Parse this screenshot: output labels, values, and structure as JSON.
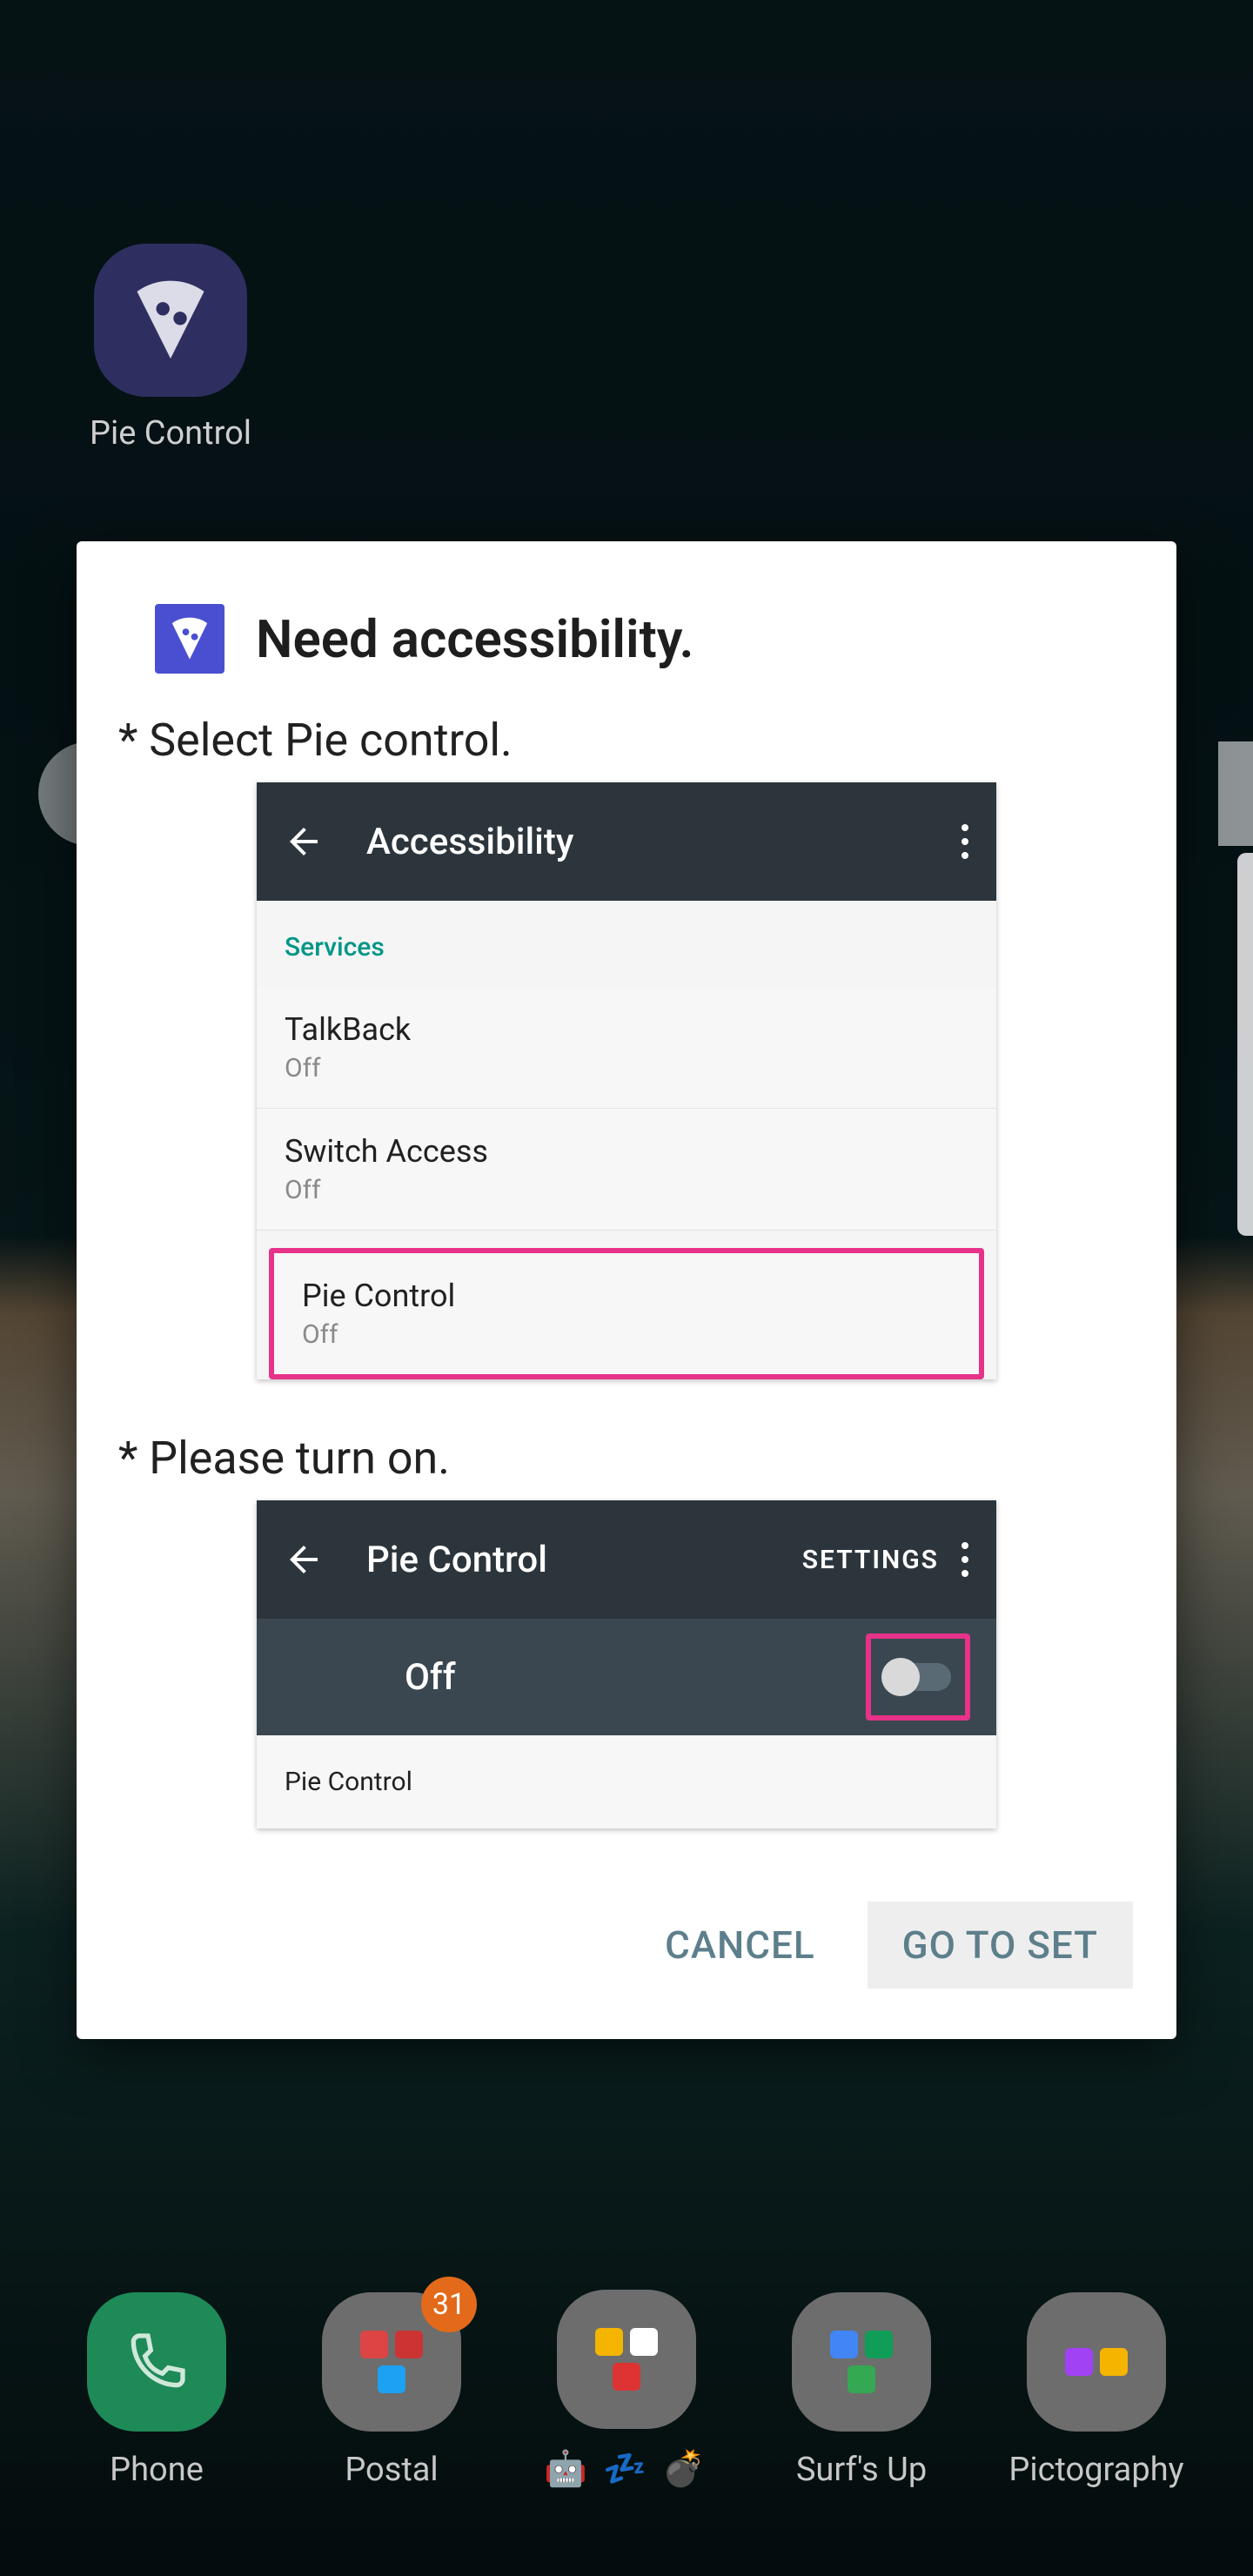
{
  "home_app": {
    "name": "Pie Control"
  },
  "dialog": {
    "title": "Need accessibility.",
    "instruction1": "* Select Pie control.",
    "instruction2": "* Please turn on.",
    "cancel": "CANCEL",
    "confirm": "GO TO SET"
  },
  "mock1": {
    "title": "Accessibility",
    "section": "Services",
    "rows": [
      {
        "name": "TalkBack",
        "status": "Off"
      },
      {
        "name": "Switch Access",
        "status": "Off"
      },
      {
        "name": "Pie Control",
        "status": "Off"
      }
    ]
  },
  "mock2": {
    "title": "Pie Control",
    "settings": "SETTINGS",
    "state": "Off",
    "body": "Pie Control"
  },
  "dock": {
    "phone": "Phone",
    "postal": "Postal",
    "postal_badge": "31",
    "surfs": "Surf's Up",
    "picto": "Pictography"
  }
}
